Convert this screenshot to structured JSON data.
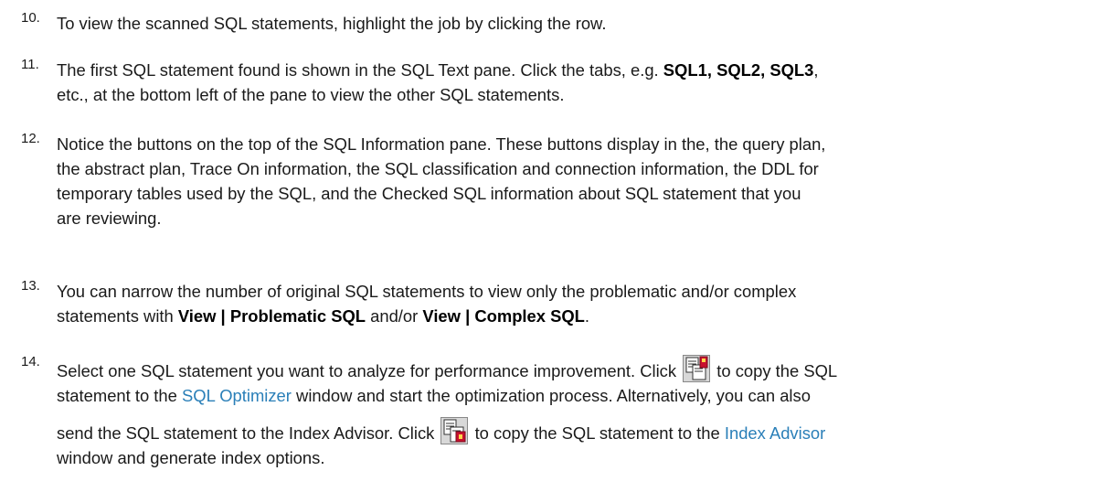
{
  "steps": [
    {
      "num": "10.",
      "text": "To view the scanned SQL statements, highlight the job by clicking the row."
    },
    {
      "num": "11.",
      "t1": "The first SQL statement found is shown in the SQL Text pane. Click the tabs, e.g. ",
      "b1": "SQL1",
      "sep1": ", ",
      "b2": "SQL2",
      "sep2": ", ",
      "b3": "SQL3",
      "t2": ",",
      "t3": "etc., at the bottom left of the pane to view the other SQL statements."
    },
    {
      "num": "12.",
      "lines": [
        "Notice the buttons on the top of the SQL Information pane. These buttons display in the, the query plan,",
        "the abstract plan, Trace On information, the SQL classification and connection information, the DDL for",
        "temporary tables used by the SQL, and the Checked SQL information about SQL statement that you",
        "are reviewing."
      ]
    },
    {
      "num": "13.",
      "t1": "You can narrow the number of original SQL statements to view only the problematic and/or complex",
      "t2": "statements with ",
      "b1": "View | Problematic SQL",
      "t3": " and/or ",
      "b2": "View | Complex SQL",
      "t4": "."
    },
    {
      "num": "14.",
      "t1": "Select one SQL statement you want to analyze for performance improvement. Click ",
      "t2": " to copy the SQL",
      "t3": "statement to the ",
      "link1": "SQL Optimizer",
      "t4": " window and start the optimization process. Alternatively, you can also",
      "t5": "send the SQL statement to the Index Advisor. Click ",
      "t6": " to copy the SQL statement to the ",
      "link2": "Index Advisor",
      "t7": "window and generate index options.",
      "icon1": "copy-to-sql-optimizer-icon",
      "icon2": "copy-to-index-advisor-icon"
    }
  ],
  "colors": {
    "text": "#1a1a1a",
    "link": "#2a7fb8"
  }
}
